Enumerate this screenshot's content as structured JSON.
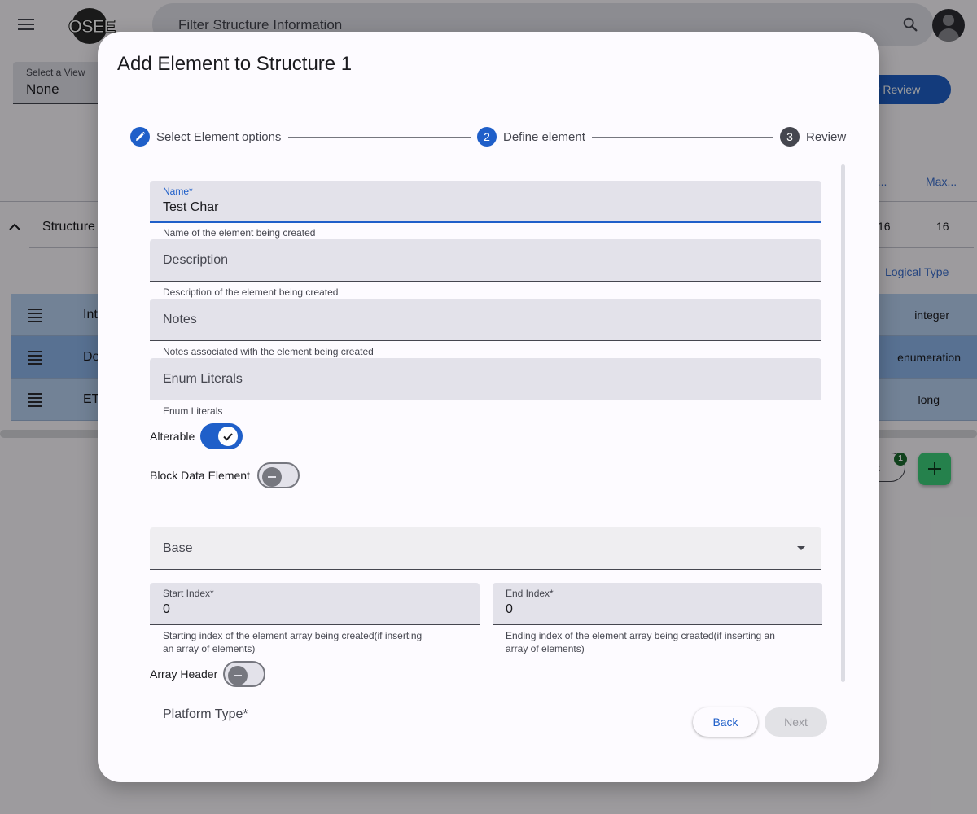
{
  "app": {
    "logo_text": "OSEE",
    "search_placeholder": "Filter Structure Information",
    "view_select_label": "Select a View",
    "view_select_value": "None",
    "review_button": "er Review",
    "table_header": {
      "col_a": "n ...",
      "col_b": "Max..."
    },
    "structure_row": {
      "label": "Structure",
      "num_a": "16",
      "num_b": "16"
    },
    "logical_type_header": "Logical Type",
    "rows": [
      {
        "text": "Int",
        "type": "integer"
      },
      {
        "text": "De",
        "type": "enumeration"
      },
      {
        "text": "ET",
        "type": "long"
      }
    ],
    "chip_text": "o:",
    "badge_count": "1"
  },
  "dialog": {
    "title": "Add Element to Structure 1",
    "steps": [
      {
        "number": "",
        "label": "Select Element options"
      },
      {
        "number": "2",
        "label": "Define element"
      },
      {
        "number": "3",
        "label": "Review"
      }
    ],
    "fields": {
      "name": {
        "label": "Name*",
        "value": "Test Char",
        "hint": "Name of the element being created"
      },
      "description": {
        "placeholder": "Description",
        "hint": "Description of the element being created"
      },
      "notes": {
        "placeholder": "Notes",
        "hint": "Notes associated with the element being created"
      },
      "enum_literals": {
        "placeholder": "Enum Literals",
        "hint": "Enum Literals"
      },
      "base": {
        "placeholder": "Base"
      },
      "start_index": {
        "label": "Start Index*",
        "value": "0",
        "hint_line1": "Starting index of the element array being created(if inserting",
        "hint_line2": "an array of elements)"
      },
      "end_index": {
        "label": "End Index*",
        "value": "0",
        "hint_line1": "Ending index of the element array being created(if inserting an",
        "hint_line2": "array of elements)"
      },
      "platform_type": {
        "label": "Platform Type*"
      }
    },
    "toggles": {
      "alterable": {
        "label": "Alterable",
        "state": "on"
      },
      "block_data_element": {
        "label": "Block Data Element",
        "state": "off"
      },
      "array_header": {
        "label": "Array Header",
        "state": "off"
      }
    },
    "buttons": {
      "back": "Back",
      "next": "Next"
    }
  },
  "colors": {
    "primary": "#1f5fc9",
    "surface": "#fdfbff",
    "field_bg": "#e3e2ea",
    "row_bg": "#b9d2f2",
    "fab": "#3dd17b"
  }
}
